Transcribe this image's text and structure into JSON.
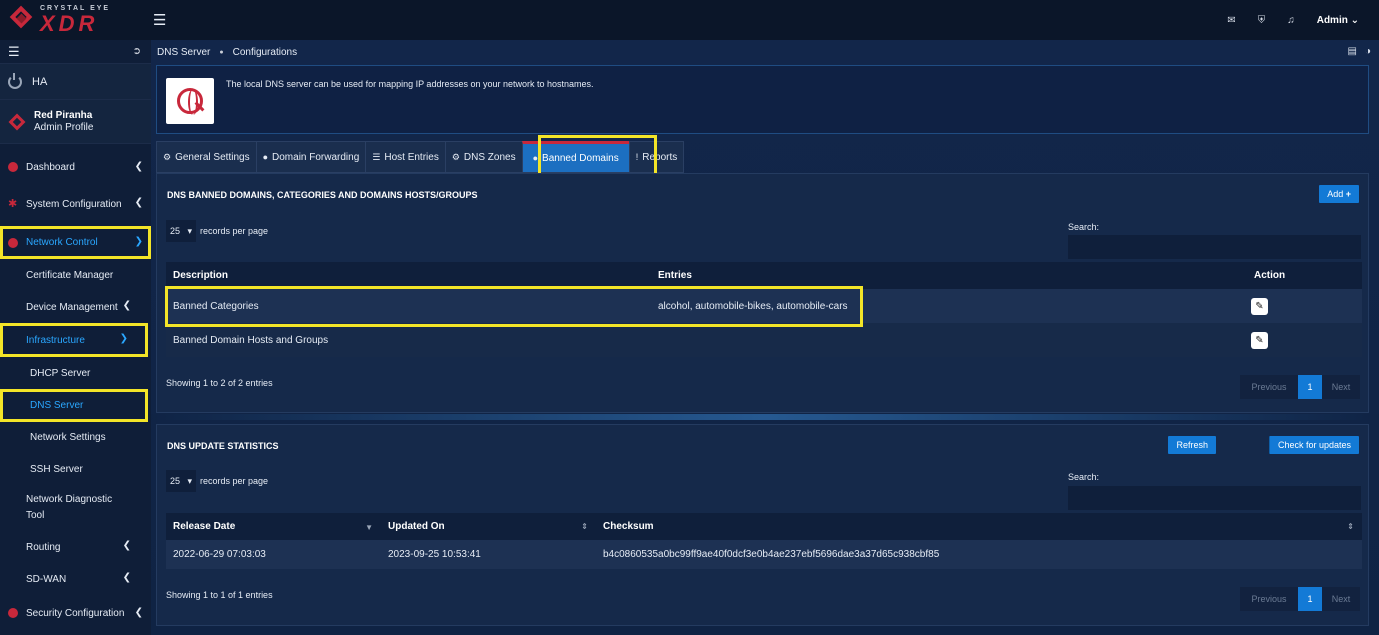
{
  "brand": {
    "logo_top": "CRYSTAL EYE",
    "logo_main": "XDR"
  },
  "sidebar": {
    "ha_label": "HA",
    "profile": {
      "name": "Red Piranha",
      "role": "Admin Profile"
    },
    "items": [
      {
        "label": "Dashboard"
      },
      {
        "label": "System Configuration"
      },
      {
        "label": "Network Control"
      },
      {
        "label": "Certificate Manager"
      },
      {
        "label": "Device Management"
      },
      {
        "label": "Infrastructure"
      },
      {
        "label": "DHCP Server"
      },
      {
        "label": "DNS Server"
      },
      {
        "label": "Network Settings"
      },
      {
        "label": "SSH Server"
      },
      {
        "label": "Network Diagnostic Tool"
      },
      {
        "label": "Routing"
      },
      {
        "label": "SD-WAN"
      },
      {
        "label": "Security Configuration"
      }
    ]
  },
  "topbar": {
    "user": "Admin"
  },
  "breadcrumb": {
    "parent": "DNS Server",
    "current": "Configurations"
  },
  "info": {
    "text": "The local DNS server can be used for mapping IP addresses on your network to hostnames."
  },
  "tabs": [
    {
      "label": "General Settings",
      "icon": "cogs-icon"
    },
    {
      "label": "Domain Forwarding",
      "icon": "globe-icon"
    },
    {
      "label": "Host Entries",
      "icon": "list-icon"
    },
    {
      "label": "DNS Zones",
      "icon": "gear-icon"
    },
    {
      "label": "Banned Domains",
      "icon": "globe-icon"
    },
    {
      "label": "Reports",
      "icon": "exclamation-icon"
    }
  ],
  "banned": {
    "title": "DNS BANNED DOMAINS, CATEGORIES AND DOMAINS HOSTS/GROUPS",
    "add_label": "Add",
    "page_size": "25",
    "page_size_suffix": "records per page",
    "search_label": "Search:",
    "columns": [
      "Description",
      "Entries",
      "Action"
    ],
    "rows": [
      {
        "description": "Banned Categories",
        "entries": "alcohol, automobile-bikes, automobile-cars"
      },
      {
        "description": "Banned Domain Hosts and Groups",
        "entries": ""
      }
    ],
    "footer": "Showing 1 to 2 of 2 entries",
    "pager": {
      "prev": "Previous",
      "page": "1",
      "next": "Next"
    }
  },
  "stats": {
    "title": "DNS UPDATE STATISTICS",
    "refresh_label": "Refresh",
    "check_label": "Check for updates",
    "page_size": "25",
    "page_size_suffix": "records per page",
    "search_label": "Search:",
    "columns": [
      "Release Date",
      "Updated On",
      "Checksum"
    ],
    "rows": [
      {
        "release": "2022-06-29 07:03:03",
        "updated": "2023-09-25 10:53:41",
        "checksum": "b4c0860535a0bc99ff9ae40f0dcf3e0b4ae237ebf5696dae3a37d65c938cbf85"
      }
    ],
    "footer": "Showing 1 to 1 of 1 entries",
    "pager": {
      "prev": "Previous",
      "page": "1",
      "next": "Next"
    }
  },
  "colors": {
    "accent": "#137ad6",
    "brand_red": "#c8283b",
    "highlight": "#f3e528",
    "background": "#0d1b33"
  }
}
